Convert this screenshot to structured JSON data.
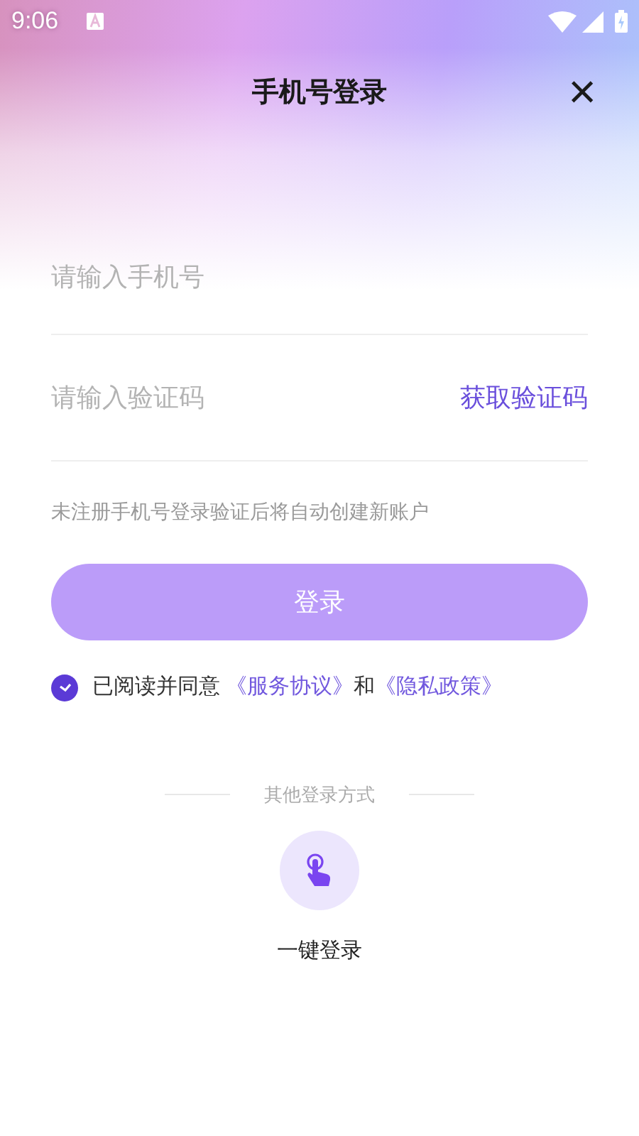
{
  "status_bar": {
    "time": "9:06"
  },
  "header": {
    "title": "手机号登录",
    "close": "×"
  },
  "phone_field": {
    "placeholder": "请输入手机号"
  },
  "code_field": {
    "placeholder": "请输入验证码",
    "action": "获取验证码"
  },
  "note": "未注册手机号登录验证后将自动创建新账户",
  "login_button": {
    "label": "登录",
    "disabled": true
  },
  "agreement": {
    "checked": true,
    "parts": [
      {
        "kind": "text",
        "text": "已阅读并同意 "
      },
      {
        "kind": "link",
        "text": "《服务协议》"
      },
      {
        "kind": "text",
        "text": "和"
      },
      {
        "kind": "link",
        "text": "《隐私政策》"
      }
    ]
  },
  "other_login": {
    "heading": "其他登录方式",
    "options": [
      {
        "label": "一键登录"
      }
    ]
  }
}
